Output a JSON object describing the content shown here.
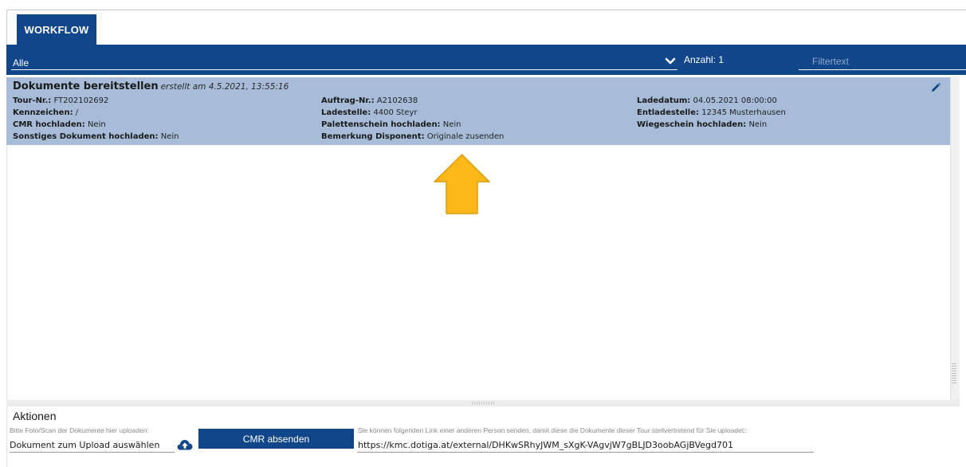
{
  "tabs": [
    {
      "label": "WORKFLOW",
      "active": true
    }
  ],
  "toolbar": {
    "filter_value": "Alle",
    "count_text": "Anzahl: 1",
    "filter_placeholder": "Filtertext"
  },
  "task": {
    "title": "Dokumente bereitstellen",
    "subtitle": "erstellt am 4.5.2021, 13:55:16",
    "columns": [
      [
        {
          "label": "Tour-Nr.:",
          "value": "FT202102692"
        },
        {
          "label": "Kennzeichen:",
          "value": "/"
        },
        {
          "label": "CMR hochladen:",
          "value": "Nein"
        },
        {
          "label": "Sonstiges Dokument hochladen:",
          "value": "Nein"
        }
      ],
      [
        {
          "label": "Auftrag-Nr.:",
          "value": "A2102638"
        },
        {
          "label": "Ladestelle:",
          "value": "4400 Steyr"
        },
        {
          "label": "Palettenschein hochladen:",
          "value": "Nein"
        },
        {
          "label": "Bemerkung Disponent:",
          "value": "Originale zusenden"
        }
      ],
      [
        {
          "label": "Ladedatum:",
          "value": "04.05.2021 08:00:00"
        },
        {
          "label": "Entladestelle:",
          "value": "12345 Musterhausen"
        },
        {
          "label": "Wiegeschein hochladen:",
          "value": "Nein"
        }
      ]
    ]
  },
  "actions": {
    "title": "Aktionen",
    "upload_hint": "Bitte Foto/Scan der Dokumente hier uploaden:",
    "upload_value": "Dokument zum Upload auswählen",
    "submit_label": "CMR absenden",
    "link_hint": "Sie können folgenden Link einer anderen Person senden, damit diese die Dokumente dieser Tour stellvertretend für Sie uploadet::",
    "link_value": "https://kmc.dotiga.at/external/DHKwSRhyJWM_sXgK-VAgvjW7gBLJD3oobAGjBVegd701"
  },
  "colors": {
    "primary": "#11468b",
    "card_background": "#a7bcd8",
    "annotation_arrow": "#fbb818"
  },
  "icons": {
    "filter_dropdown": "chevron-down-icon",
    "task_edit": "pencil-icon",
    "upload": "cloud-upload-icon",
    "annotation": "arrow-up-icon"
  }
}
